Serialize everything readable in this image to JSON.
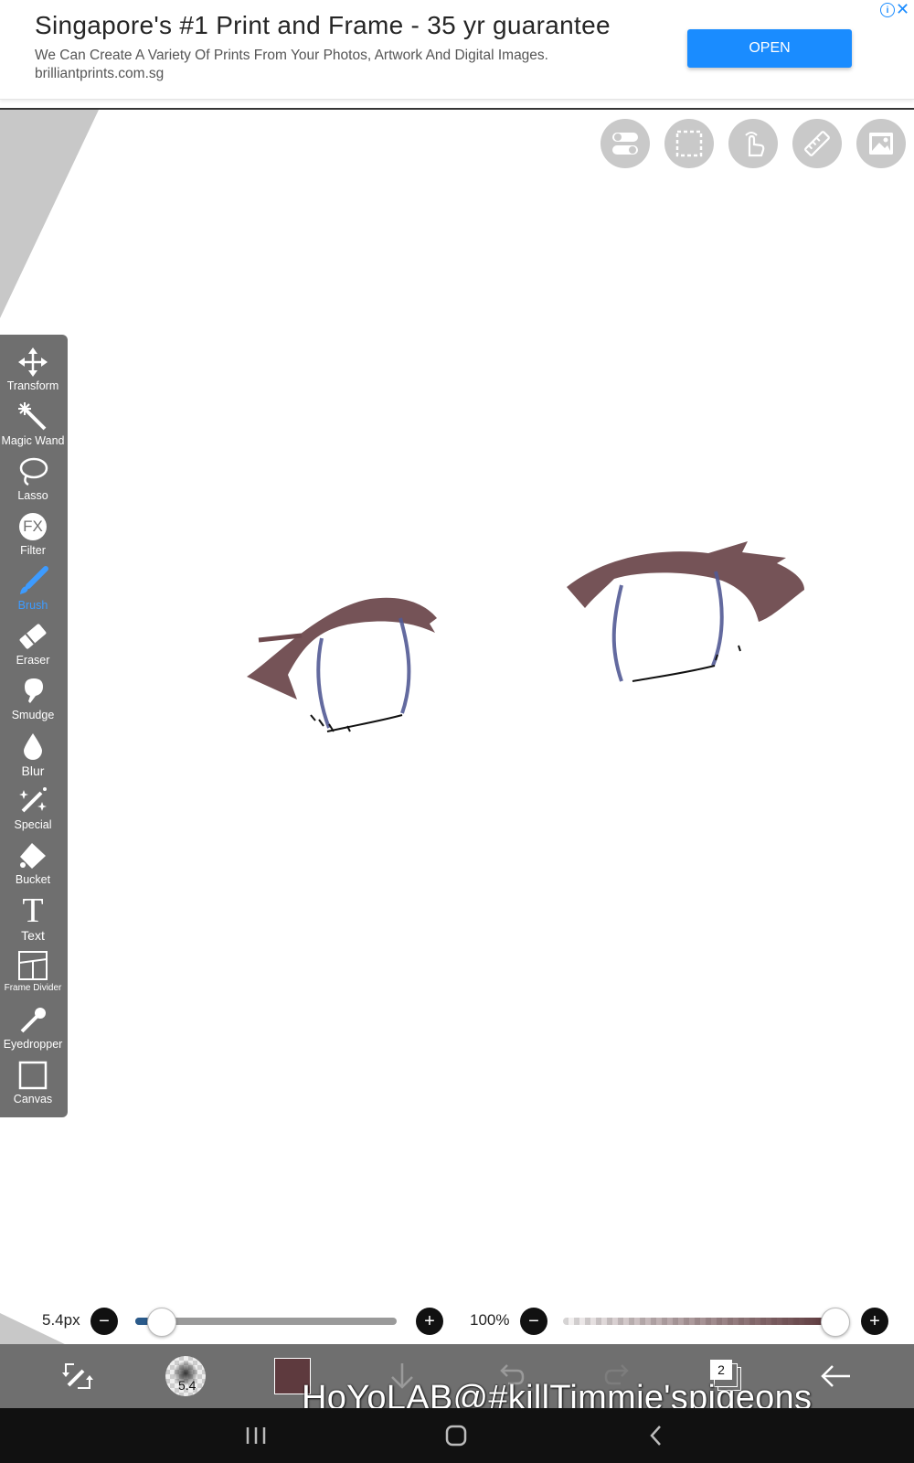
{
  "ad": {
    "title": "Singapore's #1 Print and Frame - 35 yr guarantee",
    "description": "We Can Create A Variety Of Prints From Your Photos, Artwork And Digital Images.",
    "domain": "brilliantprints.com.sg",
    "open_label": "OPEN",
    "info_glyph": "i",
    "close_glyph": "✕"
  },
  "top_tools": [
    {
      "icon": "toggle-icon"
    },
    {
      "icon": "selection-icon"
    },
    {
      "icon": "touch-icon"
    },
    {
      "icon": "ruler-icon"
    },
    {
      "icon": "image-icon"
    }
  ],
  "tools": [
    {
      "label": "Transform",
      "icon": "move-arrows-icon"
    },
    {
      "label": "Magic Wand",
      "icon": "magic-wand-icon"
    },
    {
      "label": "Lasso",
      "icon": "lasso-icon"
    },
    {
      "label": "Filter",
      "icon": "fx-icon",
      "glyph": "FX"
    },
    {
      "label": "Brush",
      "icon": "brush-icon",
      "active": true
    },
    {
      "label": "Eraser",
      "icon": "eraser-icon"
    },
    {
      "label": "Smudge",
      "icon": "smudge-icon"
    },
    {
      "label": "Blur",
      "icon": "droplet-icon"
    },
    {
      "label": "Special",
      "icon": "special-icon"
    },
    {
      "label": "Bucket",
      "icon": "bucket-icon"
    },
    {
      "label": "Text",
      "icon": "text-icon",
      "glyph": "T"
    },
    {
      "label": "Frame Divider",
      "icon": "frame-divider-icon"
    },
    {
      "label": "Eyedropper",
      "icon": "eyedropper-icon"
    },
    {
      "label": "Canvas",
      "icon": "canvas-icon"
    }
  ],
  "brush_size": {
    "label": "5.4px",
    "value": 5.4,
    "minus": "−",
    "plus": "+"
  },
  "opacity": {
    "label": "100%",
    "value": 100,
    "minus": "−",
    "plus": "+"
  },
  "bottom": {
    "brush_preview_text": "5.4",
    "layer_count": "2",
    "current_color": "#5e3a3e",
    "icons": [
      "adjust-brush-icon",
      "brush-preview-icon",
      "color-swatch-icon",
      "save-down-icon",
      "undo-icon",
      "redo-icon",
      "layers-icon",
      "back-arrow-icon"
    ]
  },
  "watermark": "HoYoLAB@#killTimmie'spigeons",
  "colors": {
    "brand_blue": "#1a8cff",
    "toolbar_gray": "#6f6f6f",
    "active_blue": "#3d9bff",
    "brow_brown": "#6e4a4e",
    "iris_blue": "#525a95"
  }
}
